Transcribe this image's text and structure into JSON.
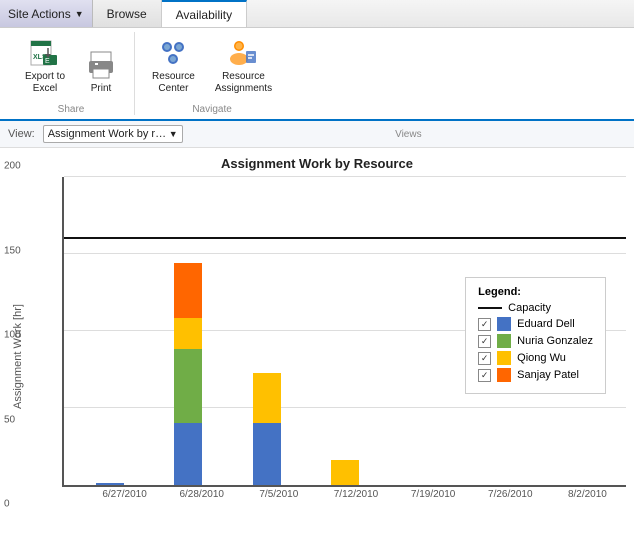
{
  "tabs": {
    "site_actions": "Site Actions",
    "browse": "Browse",
    "availability": "Availability"
  },
  "ribbon": {
    "share": {
      "label": "Share",
      "items": [
        {
          "id": "export-excel",
          "label": "Export to\nExcel"
        },
        {
          "id": "print",
          "label": "Print"
        }
      ]
    },
    "navigate": {
      "label": "Navigate",
      "items": [
        {
          "id": "resource-center",
          "label": "Resource\nCenter"
        },
        {
          "id": "resource-assignments",
          "label": "Resource\nAssignments"
        }
      ]
    }
  },
  "view": {
    "label": "View:",
    "selected": "Assignment Work by reso...",
    "section_label": "Views"
  },
  "chart": {
    "title": "Assignment Work by Resource",
    "y_axis_label": "Assignment Work [hr]",
    "y_max": 200,
    "capacity_value": 160,
    "y_ticks": [
      0,
      50,
      100,
      150,
      200
    ],
    "x_labels": [
      "6/27/2010",
      "6/28/2010",
      "7/5/2010",
      "7/12/2010",
      "7/19/2010",
      "7/26/2010",
      "8/2/2010"
    ],
    "bars": [
      {
        "date": "6/27/2010",
        "segments": [
          {
            "color": "#4472C4",
            "value": 1
          }
        ]
      },
      {
        "date": "6/28/2010",
        "segments": [
          {
            "color": "#4472C4",
            "value": 40
          },
          {
            "color": "#70AD47",
            "value": 48
          },
          {
            "color": "#FFC000",
            "value": 20
          },
          {
            "color": "#FF6600",
            "value": 35
          }
        ]
      },
      {
        "date": "7/5/2010",
        "segments": [
          {
            "color": "#4472C4",
            "value": 40
          },
          {
            "color": "#FFC000",
            "value": 32
          }
        ]
      },
      {
        "date": "7/12/2010",
        "segments": [
          {
            "color": "#FFC000",
            "value": 16
          }
        ]
      },
      {
        "date": "7/19/2010",
        "segments": []
      },
      {
        "date": "7/26/2010",
        "segments": []
      },
      {
        "date": "8/2/2010",
        "segments": []
      }
    ],
    "legend": {
      "title": "Legend:",
      "items": [
        {
          "type": "line",
          "label": "Capacity"
        },
        {
          "type": "color",
          "color": "#4472C4",
          "label": "Eduard Dell",
          "checked": true
        },
        {
          "type": "color",
          "color": "#70AD47",
          "label": "Nuria Gonzalez",
          "checked": true
        },
        {
          "type": "color",
          "color": "#FFC000",
          "label": "Qiong Wu",
          "checked": true
        },
        {
          "type": "color",
          "color": "#FF6600",
          "label": "Sanjay Patel",
          "checked": true
        }
      ]
    }
  }
}
